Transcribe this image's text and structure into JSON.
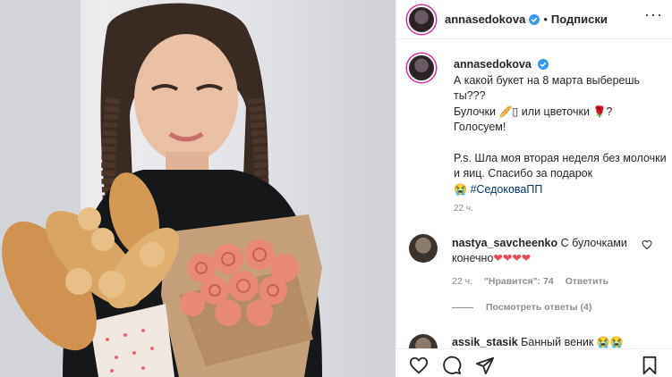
{
  "post": {
    "username": "annasedokova",
    "dot": "•",
    "follow_label": "Подписки",
    "more_label": "···"
  },
  "caption": {
    "username": "annasedokova",
    "line1": "А какой букет на 8 марта выберешь ты???",
    "line2a": "Булочки",
    "line2b": "или цветочки",
    "line2c": "?",
    "line3": "Голосуем!",
    "line4": "P.s. Шла моя вторая неделя без молочки и яиц. Спасибо за подарок",
    "hashtag": "#СедоковаПП",
    "time": "22 ч."
  },
  "comment": {
    "username": "nastya_savcheenko",
    "text": "С булочками конечно",
    "hearts": "❤❤❤❤",
    "time": "22 ч.",
    "likes": "\"Нравится\": 74",
    "reply": "Ответить",
    "view_replies": "Посмотреть ответы (4)"
  },
  "next_comment": {
    "username": "assik_stasik",
    "text": "Банный веник"
  },
  "colors": {
    "brand_ring": "#d6249f",
    "verified": "#3897f0",
    "link": "#00376b",
    "heart": "#ed4956",
    "muted": "#8e8e8e"
  },
  "icons": [
    "heart-icon",
    "comment-icon",
    "share-icon",
    "bookmark-icon",
    "verified-icon",
    "more-icon"
  ]
}
